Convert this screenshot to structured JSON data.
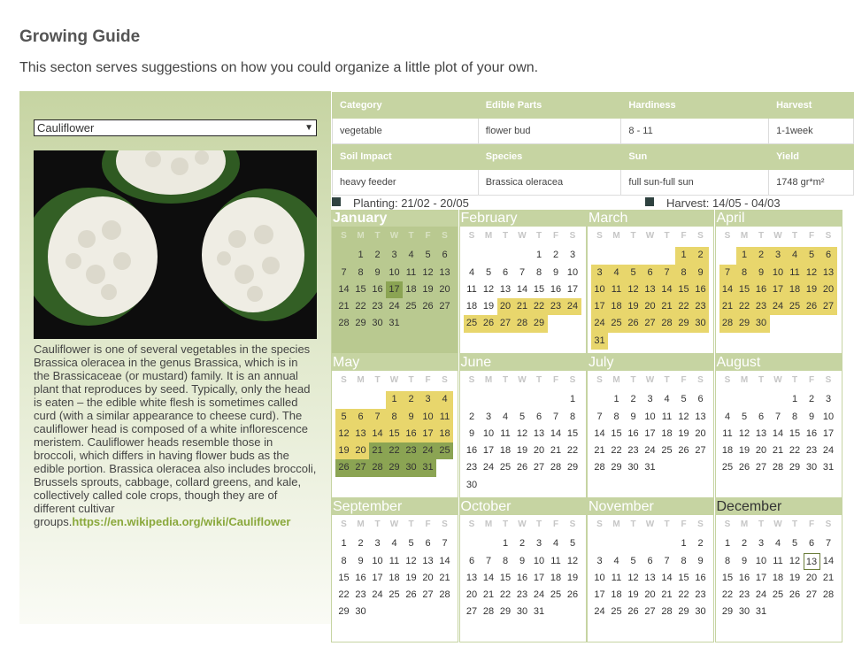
{
  "page": {
    "title": "Growing Guide",
    "intro": "This secton serves suggestions on how you could organize a little plot of your own."
  },
  "selector": {
    "value": "Cauliflower",
    "arrow_icon": "chevron-down-icon"
  },
  "description": {
    "text": "Cauliflower is one of several vegetables in the species Brassica oleracea in the genus Brassica, which is in the Brassicaceae (or mustard) family. It is an annual plant that reproduces by seed. Typically, only the head is eaten – the edible white flesh is sometimes called curd (with a similar appearance to cheese curd). The cauliflower head is composed of a white inflorescence meristem. Cauliflower heads resemble those in broccoli, which differs in having flower buds as the edible portion. Brassica oleracea also includes broccoli, Brussels sprouts, cabbage, collard greens, and kale, collectively called cole crops, though they are of different cultivar groups.",
    "link": "https://en.wikipedia.org/wiki/Cauliflower"
  },
  "info": {
    "category_label": "Category",
    "category": "vegetable",
    "edible_label": "Edible Parts",
    "edible": "flower bud",
    "hardiness_label": "Hardiness",
    "hardiness": "8 - 11",
    "harvest_label": "Harvest",
    "harvest": "1-1week",
    "soil_label": "Soil Impact",
    "soil": "heavy feeder",
    "species_label": "Species",
    "species": "Brassica oleracea",
    "sun_label": "Sun",
    "sun": "full sun-full sun",
    "yield_label": "Yield",
    "yield": "1748 gr*m²"
  },
  "legend": {
    "planting": "Planting: 21/02 - 20/05",
    "harvest": "Harvest: 14/05 - 04/03"
  },
  "colors": {
    "accent": "#c6d4a2",
    "planting": "#e8d66c",
    "harvest": "#8ba453",
    "link": "#8aa83c"
  },
  "calendar": {
    "weekdays": [
      "S",
      "M",
      "T",
      "W",
      "T",
      "F",
      "S"
    ],
    "months": [
      {
        "name": "January",
        "offset": 1,
        "days": 31,
        "plant": [],
        "harvest": [
          17
        ]
      },
      {
        "name": "February",
        "offset": 4,
        "days": 29,
        "plant": [
          20,
          21,
          22,
          23,
          24,
          25,
          26,
          27,
          28,
          29
        ],
        "harvest": []
      },
      {
        "name": "March",
        "offset": 5,
        "days": 31,
        "plant": [
          1,
          2,
          3,
          4,
          5,
          6,
          7,
          8,
          9,
          10,
          11,
          12,
          13,
          14,
          15,
          16,
          17,
          18,
          19,
          20,
          21,
          22,
          23,
          24,
          25,
          26,
          27,
          28,
          29,
          30,
          31
        ],
        "harvest": []
      },
      {
        "name": "April",
        "offset": 1,
        "days": 30,
        "plant": [
          1,
          2,
          3,
          4,
          5,
          6,
          7,
          8,
          9,
          10,
          11,
          12,
          13,
          14,
          15,
          16,
          17,
          18,
          19,
          20,
          21,
          22,
          23,
          24,
          25,
          26,
          27,
          28,
          29,
          30
        ],
        "harvest": []
      },
      {
        "name": "May",
        "offset": 3,
        "days": 31,
        "plant": [
          1,
          2,
          3,
          4,
          5,
          6,
          7,
          8,
          9,
          10,
          11,
          12,
          13,
          14,
          15,
          16,
          17,
          18,
          19,
          20
        ],
        "harvest": [
          21,
          22,
          23,
          24,
          25,
          26,
          27,
          28,
          29,
          30,
          31
        ]
      },
      {
        "name": "June",
        "offset": 6,
        "days": 30,
        "plant": [],
        "harvest": []
      },
      {
        "name": "July",
        "offset": 1,
        "days": 31,
        "plant": [],
        "harvest": []
      },
      {
        "name": "August",
        "offset": 4,
        "days": 31,
        "plant": [],
        "harvest": []
      },
      {
        "name": "September",
        "offset": 0,
        "days": 30,
        "plant": [],
        "harvest": []
      },
      {
        "name": "October",
        "offset": 2,
        "days": 31,
        "plant": [],
        "harvest": []
      },
      {
        "name": "November",
        "offset": 5,
        "days": 30,
        "plant": [],
        "harvest": []
      },
      {
        "name": "December",
        "offset": 0,
        "days": 31,
        "plant": [],
        "harvest": [],
        "today": 13
      }
    ]
  }
}
